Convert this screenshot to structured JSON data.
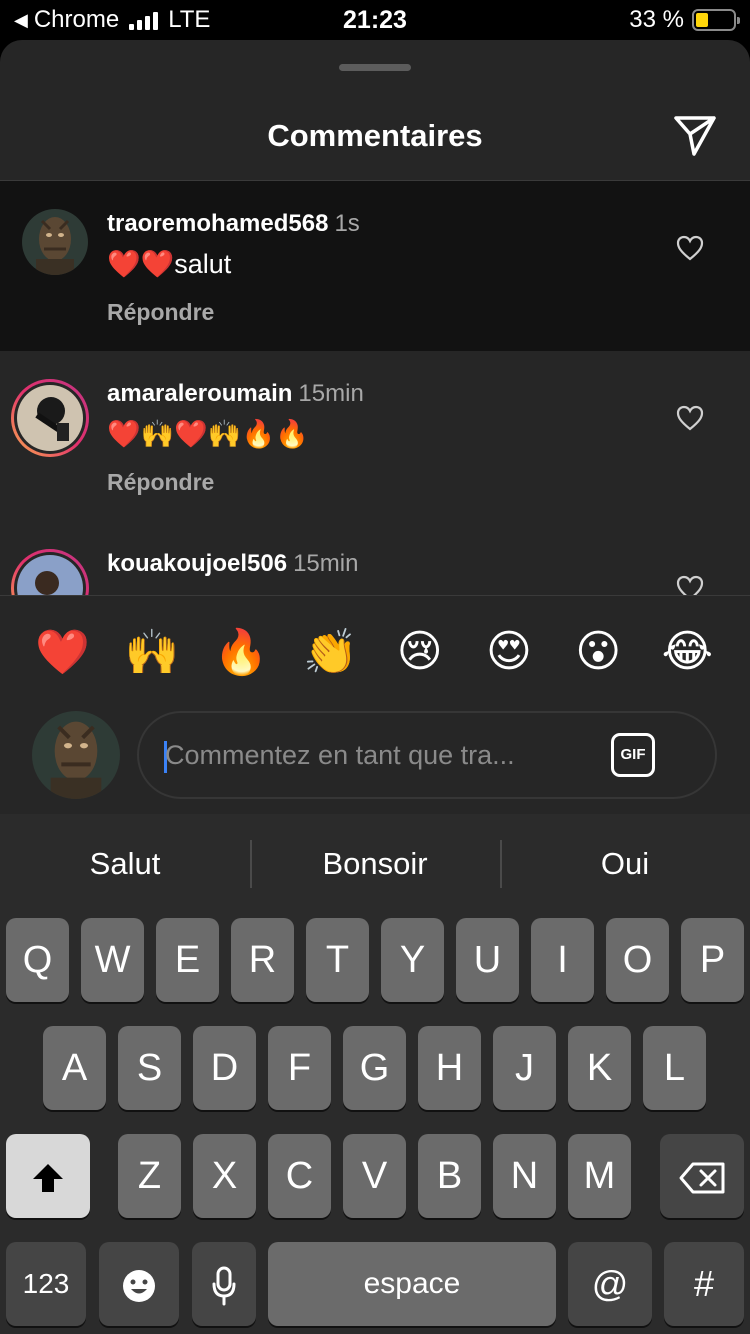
{
  "status_bar": {
    "back_app": "Chrome",
    "network": "LTE",
    "time": "21:23",
    "battery": "33 %",
    "battery_level": 0.33
  },
  "sheet": {
    "title": "Commentaires"
  },
  "comments": [
    {
      "username": "traoremohamed568",
      "time": "1s",
      "text": "❤️❤️salut",
      "reply": "Répondre"
    },
    {
      "username": "amaraleroumain",
      "time": "15min",
      "text": "❤️🙌❤️🙌🔥🔥",
      "reply": "Répondre"
    },
    {
      "username": "kouakoujoel506",
      "time": "15min",
      "text": "",
      "reply": ""
    }
  ],
  "emoji_bar": [
    "❤️",
    "🙌",
    "🔥",
    "👏",
    "😢",
    "😍",
    "😮",
    "😂"
  ],
  "comment_input": {
    "placeholder": "Commentez en tant que tra...",
    "gif_label": "GIF"
  },
  "keyboard": {
    "suggestions": [
      "Salut",
      "Bonsoir",
      "Oui"
    ],
    "row1": [
      "Q",
      "W",
      "E",
      "R",
      "T",
      "Y",
      "U",
      "I",
      "O",
      "P"
    ],
    "row2": [
      "A",
      "S",
      "D",
      "F",
      "G",
      "H",
      "J",
      "K",
      "L"
    ],
    "row3": [
      "Z",
      "X",
      "C",
      "V",
      "B",
      "N",
      "M"
    ],
    "numbers_label": "123",
    "space_label": "espace",
    "at_label": "@",
    "hash_label": "#"
  },
  "colors": {
    "sheet_bg": "#262626",
    "highlight_bg": "#121212",
    "story_ring": "#e1306c",
    "battery_fill": "#ffd60a"
  }
}
